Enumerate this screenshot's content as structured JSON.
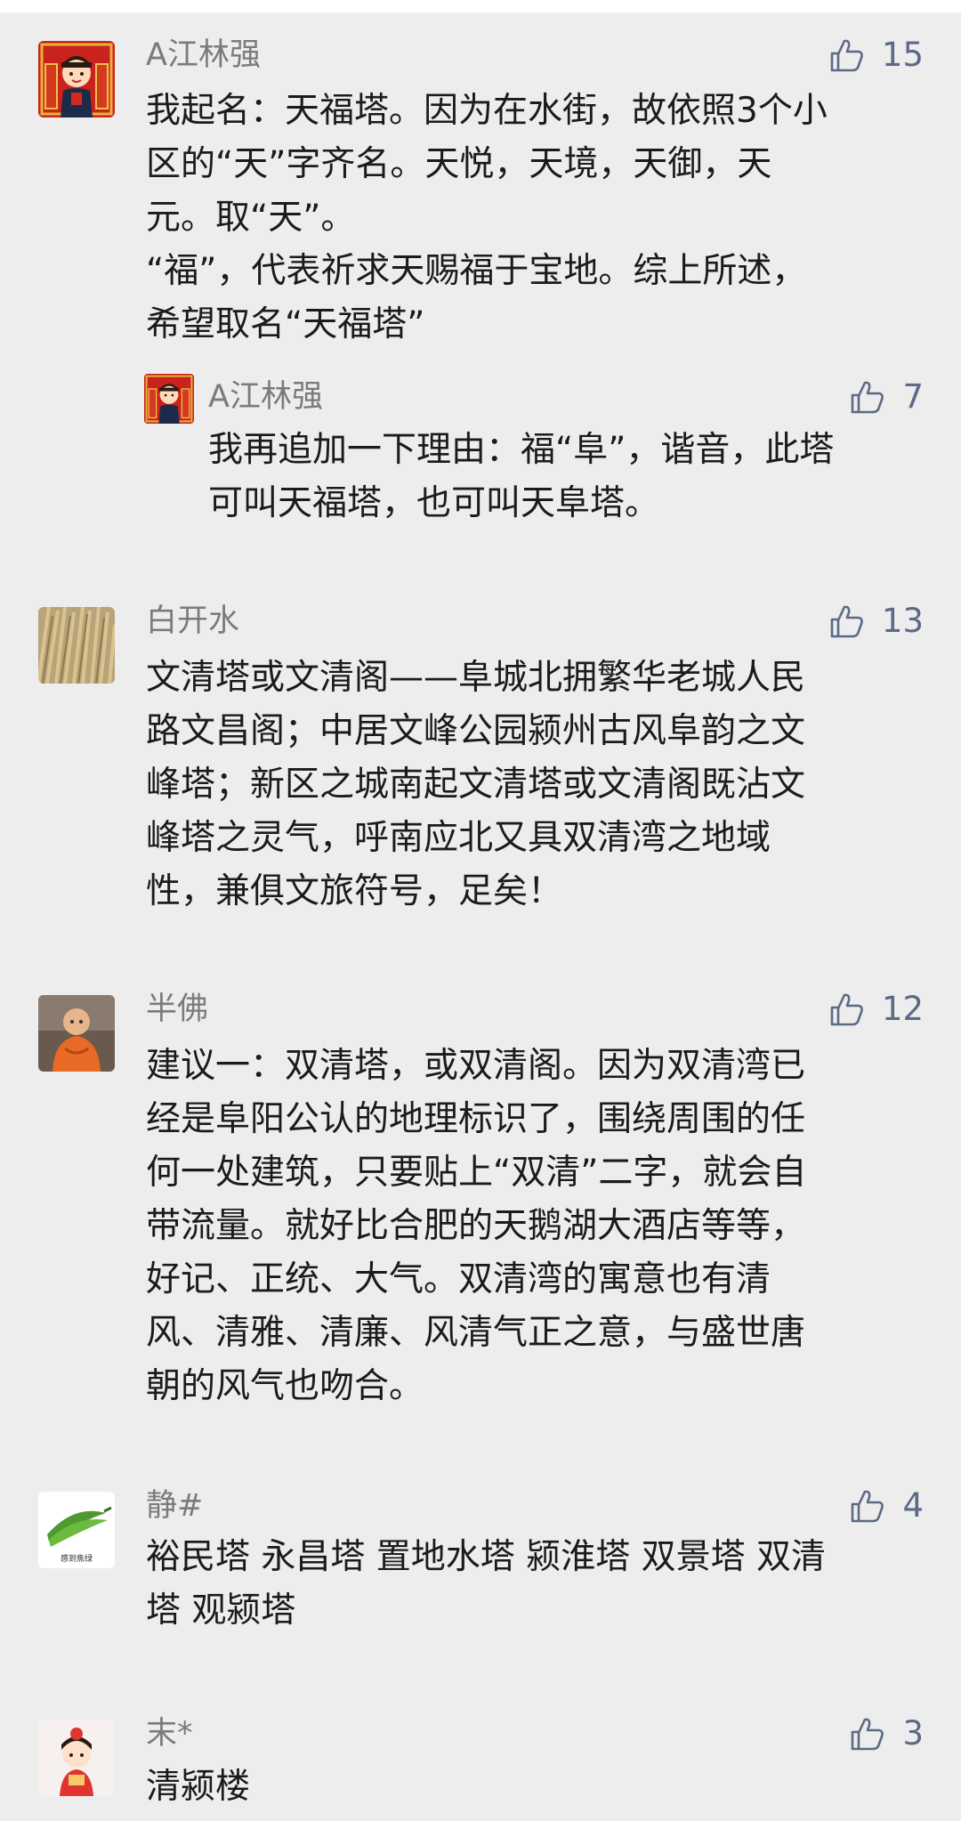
{
  "comments": [
    {
      "author": "A江林强",
      "likes": "15",
      "text": "我起名：天福塔。因为在水街，故依照3个小\n区的“天”字齐名。天悦，天境，天御，天\n元。取“天”。\n“福”，代表祈求天赐福于宝地。综上所述，\n希望取名“天福塔”",
      "reply": {
        "author": "A江林强",
        "likes": "7",
        "text": "我再追加一下理由：福“阜”，谐音，此塔\n可叫天福塔，也可叫天阜塔。"
      }
    },
    {
      "author": "白开水",
      "likes": "13",
      "text": "文清塔或文清阁——阜城北拥繁华老城人民\n路文昌阁；中居文峰公园颍州古风阜韵之文\n峰塔；新区之城南起文清塔或文清阁既沾文\n峰塔之灵气，呼南应北又具双清湾之地域\n性，兼俱文旅符号，足矣！"
    },
    {
      "author": "半佛",
      "likes": "12",
      "text": "建议一：双清塔，或双清阁。因为双清湾已\n经是阜阳公认的地理标识了，围绕周围的任\n何一处建筑，只要贴上“双清”二字，就会自\n带流量。就好比合肥的天鹅湖大酒店等等，\n好记、正统、大气。双清湾的寓意也有清\n风、清雅、清廉、风清气正之意，与盛世唐\n朝的风气也吻合。"
    },
    {
      "author": "静#",
      "likes": "4",
      "text": "裕民塔 永昌塔 置地水塔 颍淮塔 双景塔 双清\n塔 观颍塔",
      "avatar_caption": "感到焦绿"
    },
    {
      "author": "末*",
      "likes": "3",
      "text": "清颍楼"
    }
  ]
}
